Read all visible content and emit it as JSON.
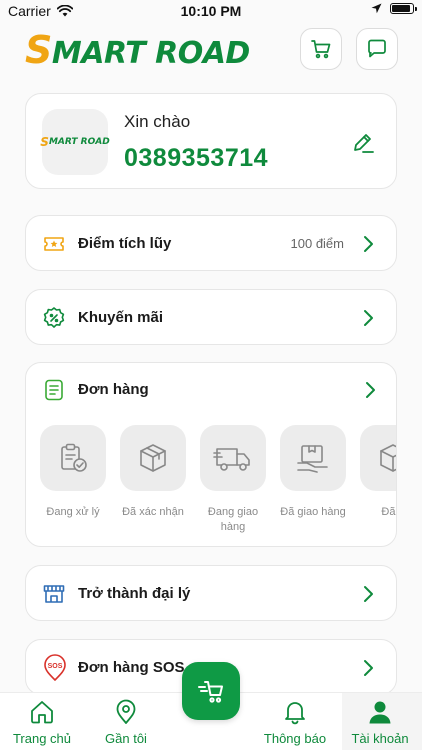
{
  "status_bar": {
    "carrier": "Carrier",
    "time": "10:10 PM",
    "battery_level": 0.9
  },
  "header": {
    "logo_text_first": "S",
    "logo_text_rest": "MART ROAD",
    "cart_icon": "cart-icon",
    "chat_icon": "chat-bubble-icon"
  },
  "profile": {
    "avatar_logo_first": "S",
    "avatar_logo_rest": "MART ROAD",
    "greeting": "Xin chào",
    "phone": "0389353714",
    "edit_icon": "pencil-icon"
  },
  "menu": {
    "points": {
      "label": "Điểm tích lũy",
      "value": "100 điểm",
      "icon": "ticket-star-icon"
    },
    "promo": {
      "label": "Khuyến mãi",
      "icon": "discount-badge-icon"
    },
    "orders": {
      "label": "Đơn hàng",
      "icon": "list-document-icon"
    },
    "agent": {
      "label": "Trở thành đại lý",
      "icon": "storefront-icon"
    },
    "sos": {
      "label": "Đơn hàng SOS",
      "icon": "sos-pin-icon"
    }
  },
  "order_steps": [
    {
      "label": "Đang xử lý",
      "icon": "clipboard-check-icon"
    },
    {
      "label": "Đã xác nhận",
      "icon": "box-icon"
    },
    {
      "label": "Đang giao hàng",
      "icon": "delivery-truck-icon"
    },
    {
      "label": "Đã giao hàng",
      "icon": "box-hand-icon"
    },
    {
      "label": "Đã h",
      "icon": "box-check-icon"
    }
  ],
  "bottom_nav": {
    "home": "Trang chủ",
    "nearby": "Gần tôi",
    "notifications": "Thông báo",
    "account": "Tài khoản"
  },
  "colors": {
    "brand_green": "#0f8a3c",
    "brand_orange": "#f0a514",
    "fab_green": "#0f9a45"
  }
}
